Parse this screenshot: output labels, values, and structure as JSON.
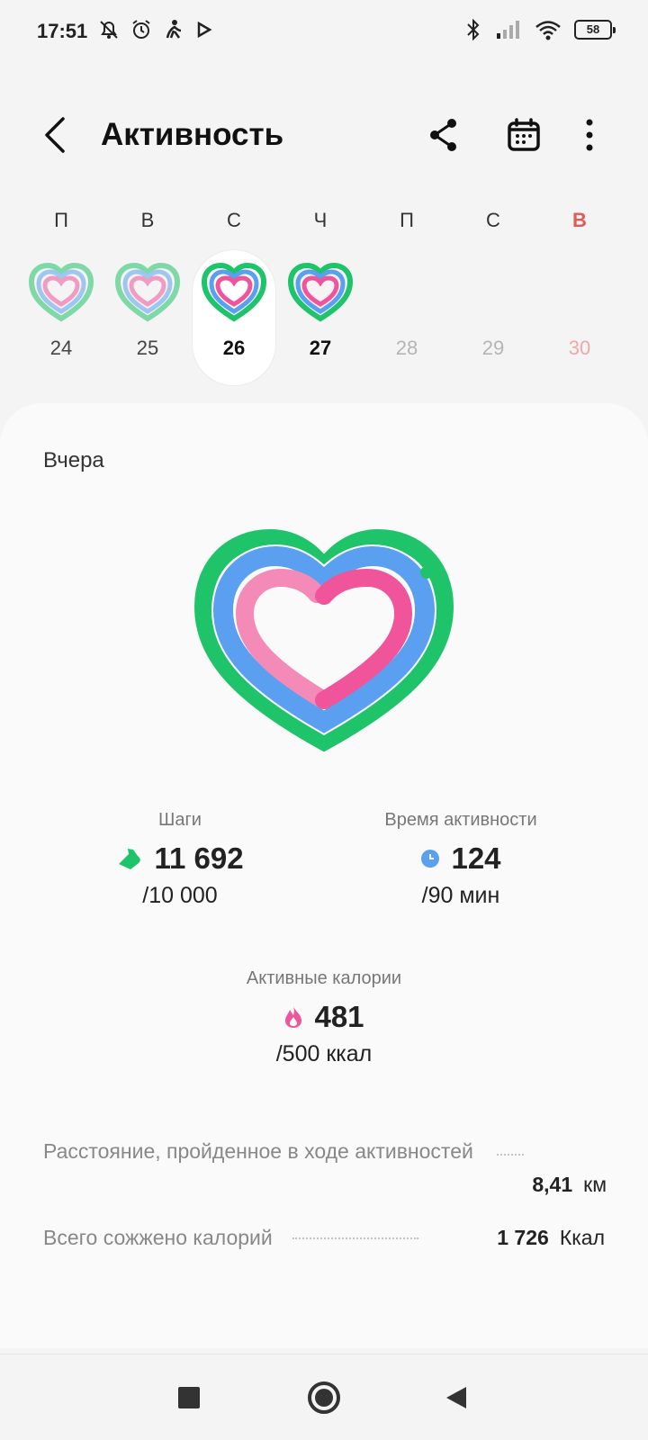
{
  "status_bar": {
    "time": "17:51",
    "battery": "58",
    "icons_left": [
      "notifications-off-icon",
      "alarm-icon",
      "fitness-icon",
      "play-store-icon"
    ],
    "icons_right": [
      "bluetooth-icon",
      "signal-icon",
      "wifi-icon",
      "battery-icon"
    ]
  },
  "header": {
    "title": "Активность",
    "icons": [
      "back-icon",
      "share-icon",
      "calendar-icon",
      "more-icon"
    ]
  },
  "week": {
    "days": [
      {
        "letter": "П",
        "num": "24",
        "has_activity": true,
        "state": "past"
      },
      {
        "letter": "В",
        "num": "25",
        "has_activity": true,
        "state": "past"
      },
      {
        "letter": "С",
        "num": "26",
        "has_activity": true,
        "state": "selected"
      },
      {
        "letter": "Ч",
        "num": "27",
        "has_activity": true,
        "state": "today"
      },
      {
        "letter": "П",
        "num": "28",
        "has_activity": false,
        "state": "future"
      },
      {
        "letter": "С",
        "num": "29",
        "has_activity": false,
        "state": "future"
      },
      {
        "letter": "В",
        "num": "30",
        "has_activity": false,
        "state": "future-sunday"
      }
    ]
  },
  "card": {
    "date_label": "Вчера",
    "rings": {
      "steps_progress": 1.17,
      "active_time_progress": 1.38,
      "calories_progress": 0.96
    },
    "steps": {
      "label": "Шаги",
      "value": "11 692",
      "goal": "/10 000",
      "icon": "shoe-icon"
    },
    "active_time": {
      "label": "Время активности",
      "value": "124",
      "goal": "/90 мин",
      "icon": "clock-icon"
    },
    "calories": {
      "label": "Активные калории",
      "value": "481",
      "goal": "/500 ккал",
      "icon": "flame-icon"
    },
    "distance": {
      "label": "Расстояние, пройденное в ходе активностей",
      "value": "8,41",
      "unit": "км"
    },
    "total_calories": {
      "label": "Всего сожжено калорий",
      "value": "1 726",
      "unit": "Ккал"
    }
  },
  "colors": {
    "green": "#1fc46a",
    "blue": "#5b9ff0",
    "pink": "#f0549a",
    "sunday": "#e05a5a"
  }
}
